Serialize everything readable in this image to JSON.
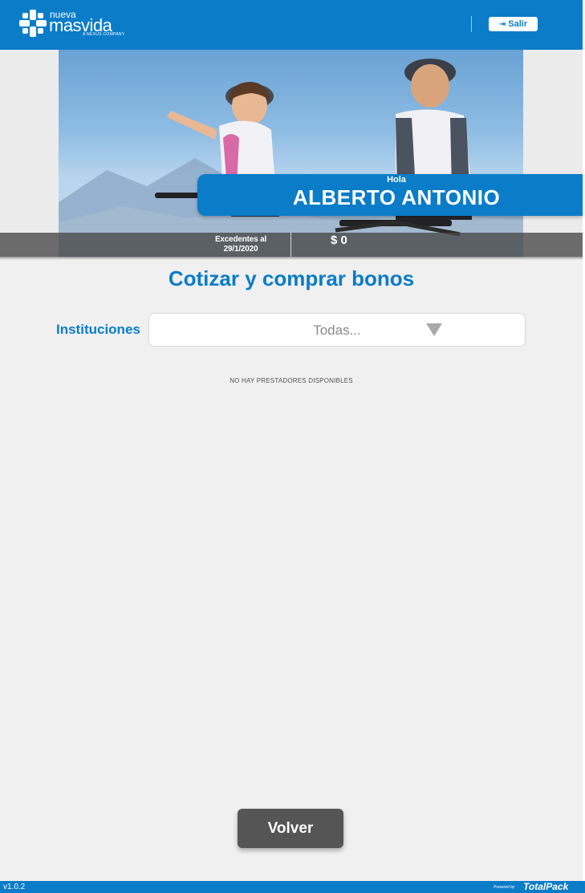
{
  "header": {
    "logo_top": "nueva",
    "logo_main": "masvida",
    "logo_sub": "A NEXUS COMPANY",
    "logout_label": "Salir",
    "logout_icon": "sign-out-icon"
  },
  "hero": {
    "greeting": "Hola",
    "user_name": "ALBERTO ANTONIO",
    "balance_label_line1": "Excedentes al",
    "balance_label_line2": "29/1/2020",
    "balance_value": "$ 0"
  },
  "main": {
    "title": "Cotizar y comprar bonos",
    "institutions_label": "Instituciones",
    "institutions_selected": "Todas...",
    "empty_message": "NO HAY PRESTADORES DISPONIBLES",
    "back_button": "Volver"
  },
  "footer": {
    "version": "v1.0.2",
    "powered_by": "Powered by",
    "brand": "TotalPack"
  },
  "colors": {
    "primary": "#0a7cc8",
    "background": "#f0f0f0",
    "button_dark": "#555555"
  }
}
